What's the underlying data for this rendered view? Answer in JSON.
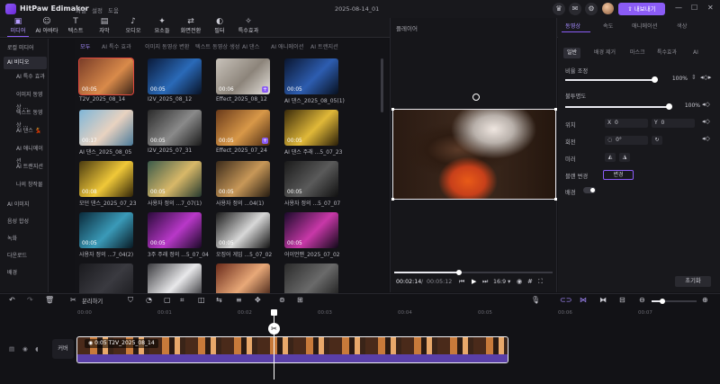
{
  "app": {
    "title": "HitPaw Edimakor",
    "menu": [
      "파일",
      "설정",
      "도움"
    ],
    "date": "2025-08-14_01",
    "export_label": "내보내기"
  },
  "toolbar": [
    {
      "icon": "media-icon",
      "glyph": "▣",
      "label": "미디어"
    },
    {
      "icon": "ai-avatar-icon",
      "glyph": "☺",
      "label": "AI 아바타"
    },
    {
      "icon": "text-icon",
      "glyph": "T",
      "label": "텍스트"
    },
    {
      "icon": "subtitle-icon",
      "glyph": "▤",
      "label": "자막"
    },
    {
      "icon": "audio-icon",
      "glyph": "♪",
      "label": "오디오"
    },
    {
      "icon": "element-icon",
      "glyph": "✦",
      "label": "요소들"
    },
    {
      "icon": "transition-icon",
      "glyph": "⇄",
      "label": "화면전환"
    },
    {
      "icon": "filter-icon",
      "glyph": "◐",
      "label": "필터"
    },
    {
      "icon": "effect-icon",
      "glyph": "✧",
      "label": "특수효과"
    }
  ],
  "sidebar": [
    {
      "label": "로컬 미디어",
      "sub": false
    },
    {
      "label": "AI 비디오",
      "sub": false
    },
    {
      "label": "AI 특수 효과",
      "sub": true
    },
    {
      "label": "이미지 동영상 ...",
      "sub": true
    },
    {
      "label": "텍스트 동영상 ...",
      "sub": true
    },
    {
      "label": "AI 댄스 💃",
      "sub": true
    },
    {
      "label": "AI 애니메이션",
      "sub": true
    },
    {
      "label": "AI 트랜지션",
      "sub": true
    },
    {
      "label": "나의 창작물",
      "sub": true
    },
    {
      "label": "AI 이미지",
      "sub": false
    },
    {
      "label": "음성 합성",
      "sub": false
    },
    {
      "label": "녹화",
      "sub": false
    },
    {
      "label": "다운로드",
      "sub": false
    },
    {
      "label": "배경",
      "sub": false
    }
  ],
  "media_tabs": [
    "모두",
    "AI 특수 효과",
    "이미지 동영상 변환",
    "텍스트 동영상 생성",
    "AI 댄스",
    "AI 애니메이션",
    "AI 트랜지션"
  ],
  "media_items": [
    {
      "name": "T2V_2025_08_14",
      "dur": "00:05",
      "selected": true,
      "plus": false,
      "bg": "linear-gradient(135deg,#7a3d28,#d98a4a 60%,#3a2418)"
    },
    {
      "name": "I2V_2025_08_12",
      "dur": "00:05",
      "selected": false,
      "plus": false,
      "bg": "linear-gradient(135deg,#0a1a3a,#2a6ab8 55%,#081226)"
    },
    {
      "name": "Effect_2025_08_12",
      "dur": "00:06",
      "selected": false,
      "plus": true,
      "bg": "linear-gradient(135deg,#c8c2ba,#8c847a 55%,#e6e2dc)"
    },
    {
      "name": "AI 댄스_2025_08_05(1)",
      "dur": "00:05",
      "selected": false,
      "plus": false,
      "bg": "linear-gradient(135deg,#0a1630,#2d5db0 55%,#07101f)"
    },
    {
      "name": "AI 댄스_2025_08_05",
      "dur": "00:17",
      "selected": false,
      "plus": false,
      "bg": "linear-gradient(135deg,#7fb6d8,#e8d2c0 55%,#4a7a9a)"
    },
    {
      "name": "I2V_2025_07_31",
      "dur": "00:05",
      "selected": false,
      "plus": false,
      "bg": "linear-gradient(135deg,#2a2a2a,#8a8a8a 55%,#1a1a1a)"
    },
    {
      "name": "Effect_2025_07_24",
      "dur": "00:05",
      "selected": false,
      "plus": true,
      "bg": "linear-gradient(135deg,#6a3a1a,#d89848 55%,#4a2a12)"
    },
    {
      "name": "AI 댄스 주래 ...5_07_23",
      "dur": "00:05",
      "selected": false,
      "plus": false,
      "bg": "linear-gradient(135deg,#3a2a0a,#e0b838 55%,#2a1e08)"
    },
    {
      "name": "모던 댄스_2025_07_23",
      "dur": "00:08",
      "selected": false,
      "plus": false,
      "bg": "linear-gradient(135deg,#4a3a10,#f0c838 55%,#302408)"
    },
    {
      "name": "사용자 정의 ...7_07(1)",
      "dur": "00:05",
      "selected": false,
      "plus": false,
      "bg": "linear-gradient(135deg,#3a5a4a,#d8b868 55%,#24382e)"
    },
    {
      "name": "사용자 정의 ...04(1)",
      "dur": "00:05",
      "selected": false,
      "plus": false,
      "bg": "linear-gradient(135deg,#3a2a1a,#c89858 55%,#241a10)"
    },
    {
      "name": "사용자 정의 ...5_07_07",
      "dur": "00:05",
      "selected": false,
      "plus": false,
      "bg": "linear-gradient(135deg,#1a1a1a,#5a5a5a 55%,#101010)"
    },
    {
      "name": "사용자 정의 ...7_04(2)",
      "dur": "00:05",
      "selected": false,
      "plus": false,
      "bg": "linear-gradient(135deg,#0a2a3a,#3a9ab8 55%,#081a24)"
    },
    {
      "name": "3주 주래 정의 ...5_07_04",
      "dur": "00:05",
      "selected": false,
      "plus": false,
      "bg": "linear-gradient(135deg,#2a0a3a,#b838c8 55%,#1a0826)"
    },
    {
      "name": "오징어 게임 ...5_07_02",
      "dur": "00:05",
      "selected": false,
      "plus": false,
      "bg": "linear-gradient(135deg,#1a1a1a,#d8d8d8 55%,#121212)"
    },
    {
      "name": "어이언맨_2025_07_02",
      "dur": "00:05",
      "selected": false,
      "plus": false,
      "bg": "linear-gradient(135deg,#1a0a2a,#c838a8 55%,#100818)"
    },
    {
      "name": "",
      "dur": "",
      "selected": false,
      "plus": false,
      "bg": "linear-gradient(135deg,#1a1a1e,#3a3a40 55%,#1a1a1e)"
    },
    {
      "name": "",
      "dur": "",
      "selected": false,
      "plus": false,
      "bg": "linear-gradient(135deg,#3a3a3e,#e8e8ea 55%,#2a2a2e)"
    },
    {
      "name": "",
      "dur": "",
      "selected": false,
      "plus": false,
      "bg": "linear-gradient(135deg,#6a2a1a,#e8a878 55%,#3a1a10)"
    },
    {
      "name": "",
      "dur": "",
      "selected": false,
      "plus": false,
      "bg": "linear-gradient(135deg,#2a2a2a,#6a6a6a 55%,#1a1a1a)"
    }
  ],
  "player": {
    "label": "플레이어",
    "time_current": "00:02:14",
    "time_total": "00:05:12",
    "ratio": "16:9",
    "progress": 0.41
  },
  "right_panel": {
    "tabs": [
      "동영상",
      "속도",
      "애니메이션",
      "색상"
    ],
    "subtabs": [
      "일반",
      "배경 제거",
      "마스크",
      "특수효과",
      "AI"
    ],
    "scale_label": "비율 조정",
    "scale_value": "100%",
    "scale_level": 1.0,
    "opacity_label": "불투명도",
    "opacity_value": "100%",
    "opacity_level": 1.0,
    "position_label": "위치",
    "x_label": "X",
    "x_value": "0",
    "y_label": "Y",
    "y_value": "0",
    "rotation_label": "회전",
    "rotation_value": "0°",
    "mirror_label": "미러",
    "blend_label": "블랜 변경",
    "blend_value": "변경",
    "background_label": "배경",
    "reset_label": "초기화"
  },
  "timeline": {
    "split_label": "분리하기",
    "ticks": [
      "00:00",
      "00:01",
      "00:02",
      "00:03",
      "00:04",
      "00:05",
      "00:06",
      "00:07"
    ],
    "track_label": "커버",
    "clip_dur": "0:05",
    "clip_name": "T2V_2025_08_14"
  }
}
